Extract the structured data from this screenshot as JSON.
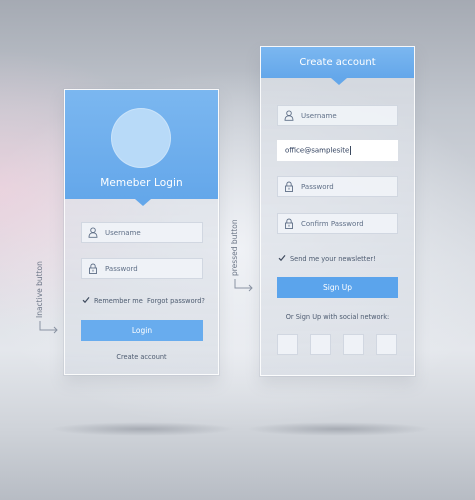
{
  "login_panel": {
    "title": "Memeber Login",
    "username_placeholder": "Username",
    "password_placeholder": "Password",
    "remember_label": "Remember me",
    "remember_checked": true,
    "forgot_label": "Forgot password?",
    "login_button_label": "Login",
    "create_account_label": "Create account"
  },
  "signup_panel": {
    "title": "Create account",
    "username_placeholder": "Username",
    "email_value": "office@samplesite",
    "password_placeholder": "Password",
    "confirm_password_placeholder": "Confirm Password",
    "newsletter_label": "Send me your newsletter!",
    "newsletter_checked": true,
    "signup_button_label": "Sign Up",
    "social_prompt": "Or Sign Up with social network:",
    "social_buttons": 4
  },
  "annotations": {
    "inactive": "Inactive button",
    "pressed": "pressed button"
  },
  "colors": {
    "accent": "#68acee",
    "accent_pressed": "#5ba4ec",
    "header": "#64a7ea",
    "avatar": "#b8daf8",
    "text": "#4d5b70"
  },
  "icons": {
    "user": "user-icon",
    "lock": "lock-icon",
    "check": "checkmark-icon"
  }
}
